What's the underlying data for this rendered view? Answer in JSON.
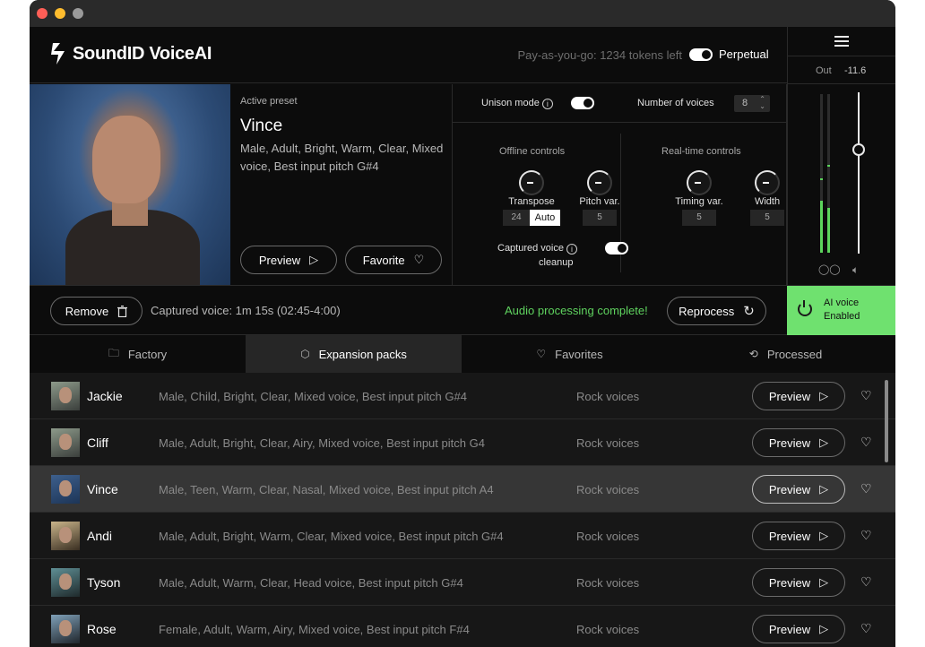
{
  "app": {
    "name": "SoundID VoiceAI",
    "tokens_text": "Pay-as-you-go: 1234 tokens left",
    "perpetual_label": "Perpetual"
  },
  "output": {
    "label": "Out",
    "value": "-11.6",
    "meter_left_level": 0.33,
    "meter_right_level": 0.28
  },
  "active_preset": {
    "label": "Active preset",
    "name": "Vince",
    "description": "Male, Adult, Bright, Warm, Clear, Mixed voice, Best input pitch  G#4",
    "preview_label": "Preview",
    "favorite_label": "Favorite"
  },
  "controls": {
    "unison_label": "Unison mode",
    "voices_label": "Number of voices",
    "voices_value": "8",
    "offline_title": "Offline controls",
    "realtime_title": "Real-time controls",
    "transpose_label": "Transpose",
    "transpose_value": "24",
    "transpose_auto": "Auto",
    "pitch_var_label": "Pitch var.",
    "pitch_var_value": "5",
    "timing_var_label": "Timing var.",
    "timing_var_value": "5",
    "width_label": "Width",
    "width_value": "5",
    "cleanup_label_1": "Captured voice",
    "cleanup_label_2": "cleanup"
  },
  "status": {
    "remove_label": "Remove",
    "captured_text": "Captured voice: 1m 15s (02:45-4:00)",
    "complete_text": "Audio processing complete!",
    "reprocess_label": "Reprocess",
    "ai_line1": "AI voice",
    "ai_line2": "Enabled",
    "ai_color": "#6fe16f"
  },
  "tabs": [
    {
      "label": "Factory",
      "icon": "folder-icon"
    },
    {
      "label": "Expansion packs",
      "icon": "package-icon"
    },
    {
      "label": "Favorites",
      "icon": "heart-icon"
    },
    {
      "label": "Processed",
      "icon": "history-icon"
    }
  ],
  "presets": [
    {
      "name": "Jackie",
      "desc": "Male, Child, Bright, Clear, Mixed voice, Best input pitch G#4",
      "pack": "Rock voices",
      "preview": "Preview"
    },
    {
      "name": "Cliff",
      "desc": "Male, Adult, Bright, Clear, Airy, Mixed voice, Best input pitch  G4",
      "pack": "Rock voices",
      "preview": "Preview"
    },
    {
      "name": "Vince",
      "desc": "Male, Teen, Warm, Clear, Nasal, Mixed voice, Best input pitch  A4",
      "pack": "Rock voices",
      "preview": "Preview"
    },
    {
      "name": "Andi",
      "desc": "Male, Adult, Bright, Warm, Clear, Mixed voice, Best input pitch  G#4",
      "pack": "Rock voices",
      "preview": "Preview"
    },
    {
      "name": "Tyson",
      "desc": "Male, Adult, Warm, Clear, Head voice, Best input pitch  G#4",
      "pack": "Rock voices",
      "preview": "Preview"
    },
    {
      "name": "Rose",
      "desc": "Female, Adult, Warm, Airy, Mixed voice, Best input pitch  F#4",
      "pack": "Rock voices",
      "preview": "Preview"
    }
  ]
}
